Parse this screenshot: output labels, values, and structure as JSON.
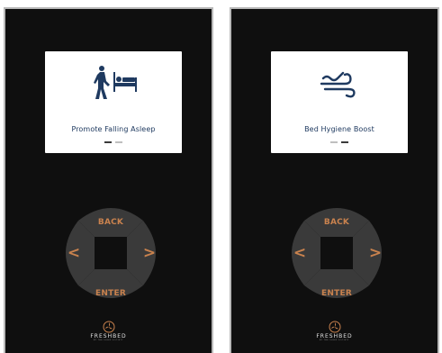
{
  "panels": [
    {
      "screen": {
        "title": "Promote Falling Asleep",
        "icon": "person-walking-to-bed-icon",
        "active_dot": 1
      },
      "pad": {
        "back": "BACK",
        "enter": "ENTER",
        "left": "<",
        "right": ">"
      },
      "logo": {
        "text": "FRESHBED",
        "sub": "BY THE SLEEP SOCIETY"
      }
    },
    {
      "screen": {
        "title": "Bed Hygiene Boost",
        "icon": "wind-icon",
        "active_dot": 2
      },
      "pad": {
        "back": "BACK",
        "enter": "ENTER",
        "left": "<",
        "right": ">"
      },
      "logo": {
        "text": "FRESHBED",
        "sub": "BY THE SLEEP SOCIETY"
      }
    }
  ],
  "colors": {
    "panel_bg": "#0f0f0f",
    "accent": "#c9824e",
    "title_text": "#1f3a60",
    "pad": "#3a3a3a"
  }
}
